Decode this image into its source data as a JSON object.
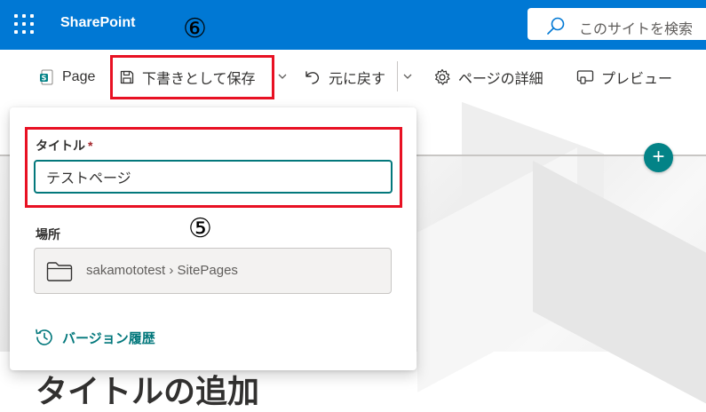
{
  "suite_bar": {
    "brand": "SharePoint",
    "search_placeholder": "このサイトを検索"
  },
  "annotations": {
    "save_marker": "⑥",
    "title_marker": "⑤"
  },
  "command_bar": {
    "page_label": "Page",
    "save_draft_label": "下書きとして保存",
    "undo_label": "元に戻す",
    "page_details_label": "ページの詳細",
    "preview_label": "プレビュー"
  },
  "panel": {
    "title_label": "タイトル",
    "required_mark": "*",
    "title_value": "テストページ",
    "location_label": "場所",
    "location_path": "sakamototest › SitePages",
    "version_history_label": "バージョン履歴"
  },
  "canvas": {
    "add_section_symbol": "+",
    "title_placeholder": "タイトルの追加"
  },
  "colors": {
    "suite_bar": "#0078d4",
    "accent_teal": "#03787c",
    "highlight_red": "#e81123"
  },
  "icons": [
    "waffle-icon",
    "search-icon",
    "sharepoint-page-icon",
    "save-icon",
    "undo-icon",
    "gear-icon",
    "preview-icon",
    "folder-icon",
    "history-icon",
    "chevron-down-icon",
    "plus-icon"
  ]
}
